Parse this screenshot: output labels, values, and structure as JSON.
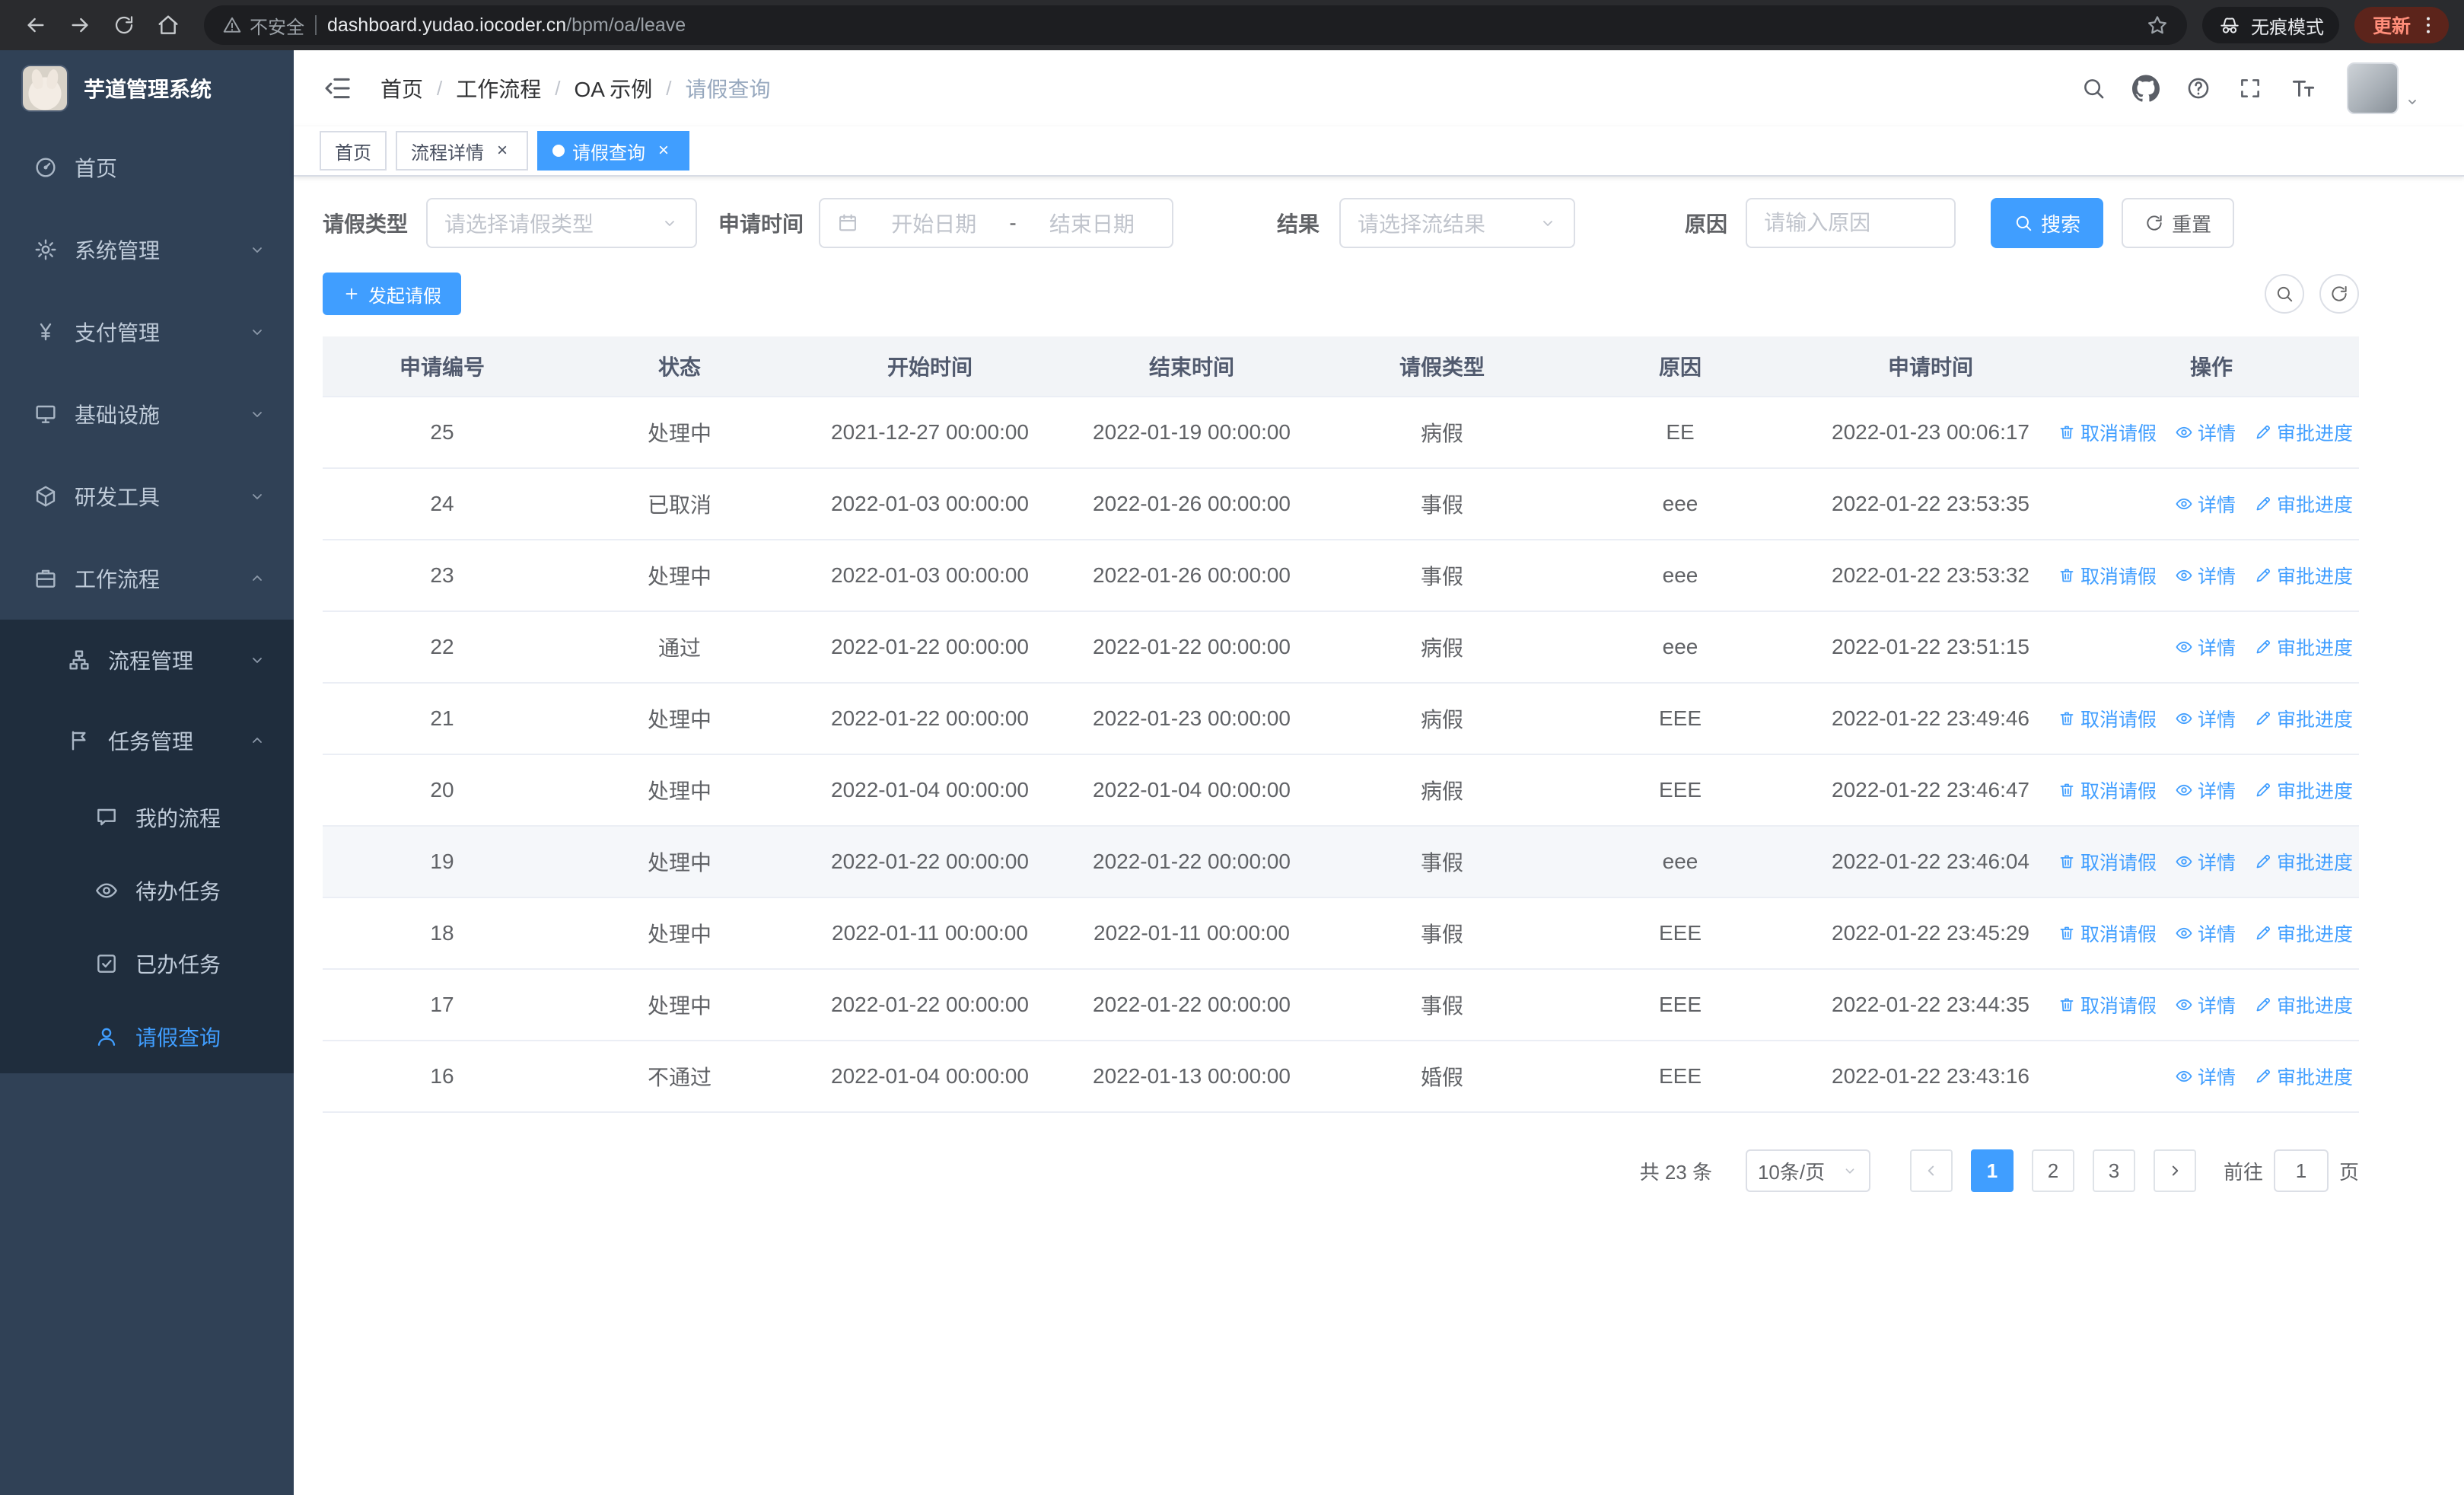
{
  "browser": {
    "security_label": "不安全",
    "url_domain": "dashboard.yudao.iocoder.cn",
    "url_path": "/bpm/oa/leave",
    "incognito_label": "无痕模式",
    "update_label": "更新"
  },
  "sidebar": {
    "logo_title": "芋道管理系统",
    "items": [
      {
        "label": "首页"
      },
      {
        "label": "系统管理"
      },
      {
        "label": "支付管理"
      },
      {
        "label": "基础设施"
      },
      {
        "label": "研发工具"
      },
      {
        "label": "工作流程"
      }
    ],
    "workflow_children": [
      {
        "label": "流程管理"
      },
      {
        "label": "任务管理"
      }
    ],
    "task_children": [
      {
        "label": "我的流程"
      },
      {
        "label": "待办任务"
      },
      {
        "label": "已办任务"
      },
      {
        "label": "请假查询"
      }
    ]
  },
  "header": {
    "breadcrumb": [
      "首页",
      "工作流程",
      "OA 示例",
      "请假查询"
    ]
  },
  "tabs": [
    {
      "label": "首页"
    },
    {
      "label": "流程详情"
    },
    {
      "label": "请假查询"
    }
  ],
  "filters": {
    "leave_type_label": "请假类型",
    "leave_type_placeholder": "请选择请假类型",
    "apply_time_label": "申请时间",
    "start_placeholder": "开始日期",
    "range_separator": "-",
    "end_placeholder": "结束日期",
    "result_label": "结果",
    "result_placeholder": "请选择流结果",
    "reason_label": "原因",
    "reason_placeholder": "请输入原因",
    "search_label": "搜索",
    "reset_label": "重置"
  },
  "toolbar": {
    "create_label": "发起请假"
  },
  "table": {
    "columns": [
      "申请编号",
      "状态",
      "开始时间",
      "结束时间",
      "请假类型",
      "原因",
      "申请时间",
      "操作"
    ],
    "actions": {
      "cancel": "取消请假",
      "detail": "详情",
      "progress": "审批进度"
    },
    "rows": [
      {
        "id": "25",
        "status": "处理中",
        "start_time": "2021-12-27 00:00:00",
        "end_time": "2022-01-19 00:00:00",
        "leave_type": "病假",
        "reason": "EE",
        "apply_time": "2022-01-23 00:06:17",
        "can_cancel": true,
        "highlighted": false
      },
      {
        "id": "24",
        "status": "已取消",
        "start_time": "2022-01-03 00:00:00",
        "end_time": "2022-01-26 00:00:00",
        "leave_type": "事假",
        "reason": "eee",
        "apply_time": "2022-01-22 23:53:35",
        "can_cancel": false,
        "highlighted": false
      },
      {
        "id": "23",
        "status": "处理中",
        "start_time": "2022-01-03 00:00:00",
        "end_time": "2022-01-26 00:00:00",
        "leave_type": "事假",
        "reason": "eee",
        "apply_time": "2022-01-22 23:53:32",
        "can_cancel": true,
        "highlighted": false
      },
      {
        "id": "22",
        "status": "通过",
        "start_time": "2022-01-22 00:00:00",
        "end_time": "2022-01-22 00:00:00",
        "leave_type": "病假",
        "reason": "eee",
        "apply_time": "2022-01-22 23:51:15",
        "can_cancel": false,
        "highlighted": false
      },
      {
        "id": "21",
        "status": "处理中",
        "start_time": "2022-01-22 00:00:00",
        "end_time": "2022-01-23 00:00:00",
        "leave_type": "病假",
        "reason": "EEE",
        "apply_time": "2022-01-22 23:49:46",
        "can_cancel": true,
        "highlighted": false
      },
      {
        "id": "20",
        "status": "处理中",
        "start_time": "2022-01-04 00:00:00",
        "end_time": "2022-01-04 00:00:00",
        "leave_type": "病假",
        "reason": "EEE",
        "apply_time": "2022-01-22 23:46:47",
        "can_cancel": true,
        "highlighted": false
      },
      {
        "id": "19",
        "status": "处理中",
        "start_time": "2022-01-22 00:00:00",
        "end_time": "2022-01-22 00:00:00",
        "leave_type": "事假",
        "reason": "eee",
        "apply_time": "2022-01-22 23:46:04",
        "can_cancel": true,
        "highlighted": true
      },
      {
        "id": "18",
        "status": "处理中",
        "start_time": "2022-01-11 00:00:00",
        "end_time": "2022-01-11 00:00:00",
        "leave_type": "事假",
        "reason": "EEE",
        "apply_time": "2022-01-22 23:45:29",
        "can_cancel": true,
        "highlighted": false
      },
      {
        "id": "17",
        "status": "处理中",
        "start_time": "2022-01-22 00:00:00",
        "end_time": "2022-01-22 00:00:00",
        "leave_type": "事假",
        "reason": "EEE",
        "apply_time": "2022-01-22 23:44:35",
        "can_cancel": true,
        "highlighted": false
      },
      {
        "id": "16",
        "status": "不通过",
        "start_time": "2022-01-04 00:00:00",
        "end_time": "2022-01-13 00:00:00",
        "leave_type": "婚假",
        "reason": "EEE",
        "apply_time": "2022-01-22 23:43:16",
        "can_cancel": false,
        "highlighted": false
      }
    ]
  },
  "pagination": {
    "total_text": "共 23 条",
    "page_size_label": "10条/页",
    "pages": [
      "1",
      "2",
      "3"
    ],
    "active_page": "1",
    "goto_prefix": "前往",
    "goto_value": "1",
    "goto_suffix": "页"
  },
  "colors": {
    "primary": "#409eff",
    "sidebar_bg": "#304156",
    "sidebar_sub_bg": "#1f2d3d",
    "active_tab_bg": "#409eff"
  }
}
